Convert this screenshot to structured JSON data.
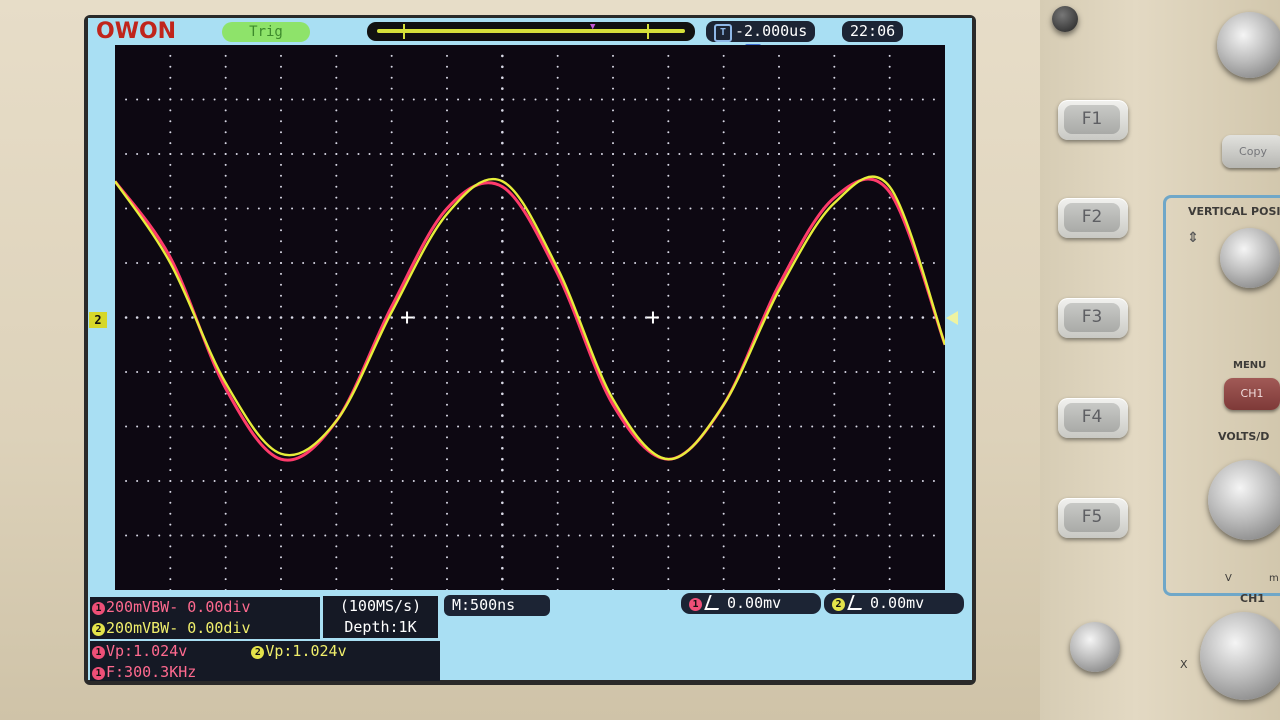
{
  "brand": {
    "logo": "OWON"
  },
  "status": {
    "trigger_state": "Trig",
    "trigger_time": "-2.000us",
    "clock": "22:06"
  },
  "channels": {
    "ch1": {
      "number": "1",
      "scale": "200mVBW- 0.00div",
      "vp": "Vp:1.024v",
      "freq": "F:300.3KHz",
      "trigger_level": "0.00mv",
      "color": "#ff3b6b"
    },
    "ch2": {
      "number": "2",
      "scale": "200mVBW- 0.00div",
      "vp": "Vp:1.024v",
      "trigger_level": "0.00mv",
      "color": "#e6ee3a"
    }
  },
  "acquisition": {
    "sample_rate": "(100MS/s)",
    "depth": "Depth:1K",
    "timebase": "M:500ns"
  },
  "markers": {
    "trigger_position": "T",
    "ch2_ground": "2"
  },
  "soft_keys": [
    "F1",
    "F2",
    "F3",
    "F4",
    "F5"
  ],
  "panel": {
    "copy_label": "Copy",
    "vertical_position_label": "VERTICAL POSI",
    "menu_label": "MENU",
    "ch1_button": "CH1",
    "volts_div_label": "VOLTS/D",
    "ch1_label": "CH1",
    "v_label": "V",
    "m_label": "m",
    "x_label": "X"
  },
  "chart_data": {
    "type": "line",
    "title": "",
    "xlabel": "",
    "ylabel": "",
    "x_divisions": 15,
    "y_divisions": 10,
    "grid": true,
    "xlim": [
      0,
      15
    ],
    "ylim": [
      -5,
      5
    ],
    "series": [
      {
        "color": "#ff3b6b",
        "x": [
          0,
          1,
          2,
          3,
          4,
          5,
          6,
          7,
          8,
          9,
          10,
          11,
          12,
          13,
          14,
          15
        ],
        "y": [
          2.5,
          1.1,
          -1.3,
          -2.6,
          -1.9,
          0.2,
          2.0,
          2.4,
          0.8,
          -1.6,
          -2.6,
          -1.6,
          0.6,
          2.2,
          2.3,
          -0.5
        ]
      },
      {
        "color": "#e6ee3a",
        "x": [
          0,
          1,
          2,
          3,
          4,
          5,
          6,
          7,
          8,
          9,
          10,
          11,
          12,
          13,
          14,
          15
        ],
        "y": [
          2.5,
          1.0,
          -1.2,
          -2.5,
          -1.9,
          0.1,
          1.9,
          2.5,
          0.9,
          -1.5,
          -2.6,
          -1.6,
          0.5,
          2.1,
          2.4,
          -0.5
        ]
      }
    ]
  }
}
